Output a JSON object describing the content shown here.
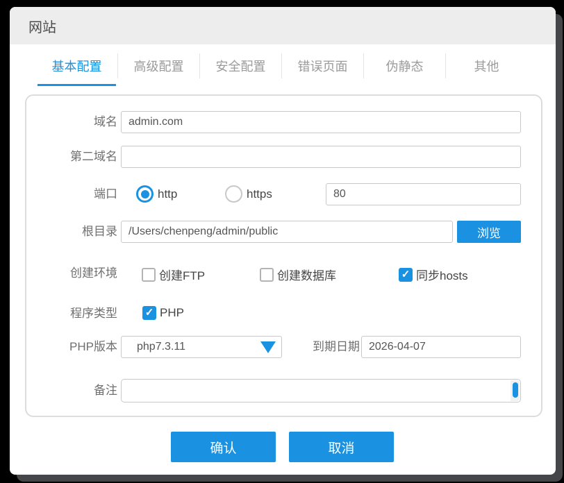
{
  "window": {
    "title": "网站"
  },
  "tabs": [
    {
      "label": "基本配置",
      "active": true
    },
    {
      "label": "高级配置",
      "active": false
    },
    {
      "label": "安全配置",
      "active": false
    },
    {
      "label": "错误页面",
      "active": false
    },
    {
      "label": "伪静态",
      "active": false
    },
    {
      "label": "其他",
      "active": false
    }
  ],
  "form": {
    "domain": {
      "label": "域名",
      "value": "admin.com"
    },
    "second_domain": {
      "label": "第二域名",
      "value": ""
    },
    "port": {
      "label": "端口",
      "options": [
        {
          "label": "http",
          "selected": true
        },
        {
          "label": "https",
          "selected": false
        }
      ],
      "value": "80"
    },
    "root": {
      "label": "根目录",
      "value": "/Users/chenpeng/admin/public",
      "browse_label": "浏览"
    },
    "env": {
      "label": "创建环境",
      "checkboxes": [
        {
          "label": "创建FTP",
          "checked": false
        },
        {
          "label": "创建数据库",
          "checked": false
        },
        {
          "label": "同步hosts",
          "checked": true
        }
      ]
    },
    "program_type": {
      "label": "程序类型",
      "checkboxes": [
        {
          "label": "PHP",
          "checked": true
        }
      ]
    },
    "php_version": {
      "label": "PHP版本",
      "value": "php7.3.11"
    },
    "expire_date": {
      "label": "到期日期",
      "value": "2026-04-07"
    },
    "remark": {
      "label": "备注",
      "value": ""
    }
  },
  "footer": {
    "confirm_label": "确认",
    "cancel_label": "取消"
  },
  "colors": {
    "accent": "#1b92e1",
    "titlebar_bg": "#ededed",
    "backdrop_edge": "#44464a"
  }
}
